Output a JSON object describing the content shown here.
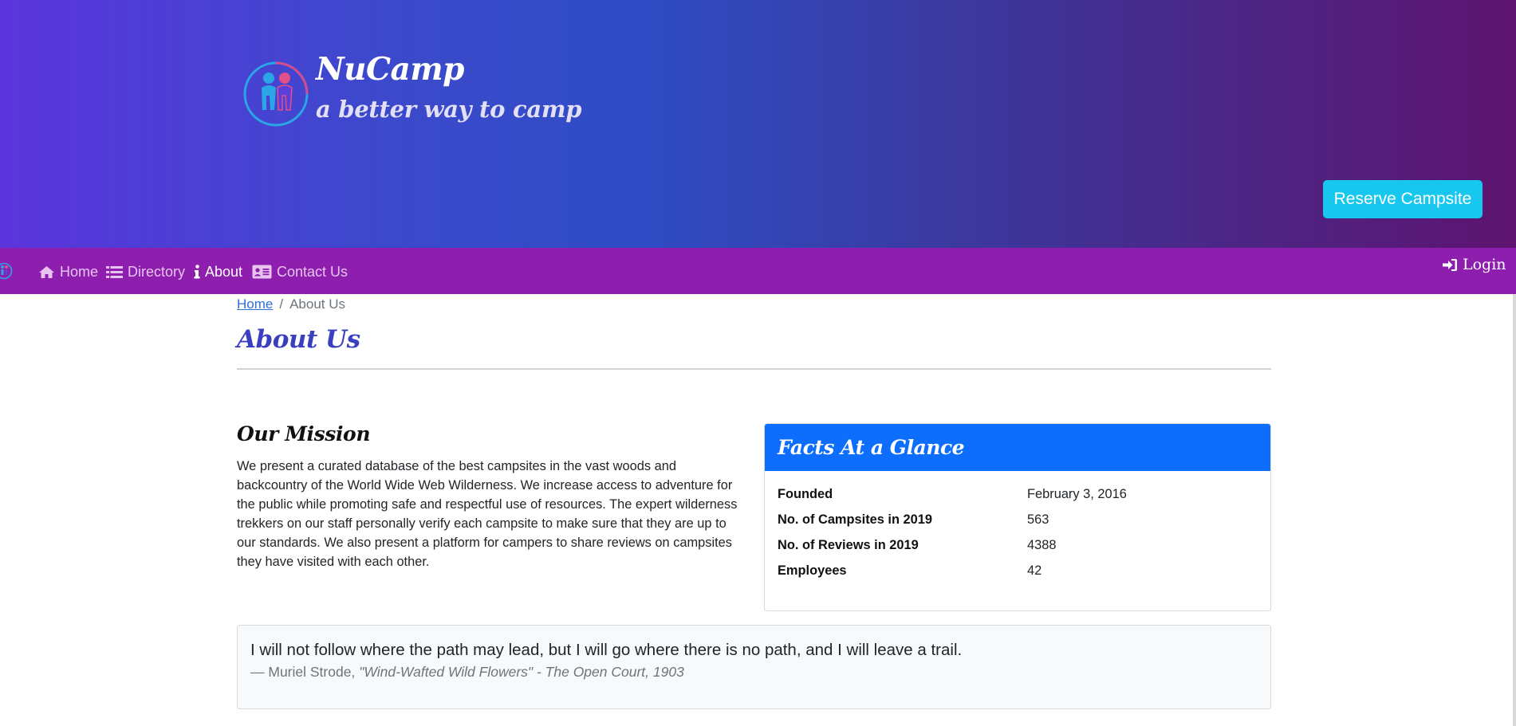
{
  "header": {
    "brand_title": "NuCamp",
    "brand_tagline": "a better way to camp",
    "logo_icon": "nucamp-logo-icon",
    "reserve_label": "Reserve Campsite",
    "colors": {
      "gradient_start": "#5b35dc",
      "gradient_end": "#5e1470",
      "reserve_button": "#17c7ee"
    }
  },
  "navbar": {
    "background": "#8e1fae",
    "items": [
      {
        "label": "Home",
        "icon": "home-icon",
        "active": false
      },
      {
        "label": "Directory",
        "icon": "list-icon",
        "active": false
      },
      {
        "label": "About",
        "icon": "info-icon",
        "active": true
      },
      {
        "label": "Contact Us",
        "icon": "address-card-icon",
        "active": false
      }
    ],
    "login_label": "Login",
    "login_icon": "sign-in-icon"
  },
  "breadcrumb": {
    "home": "Home",
    "separator": "/",
    "current": "About Us"
  },
  "page": {
    "title": "About Us"
  },
  "mission": {
    "heading": "Our Mission",
    "text": "We present a curated database of the best campsites in the vast woods and backcountry of the World Wide Web Wilderness. We increase access to adventure for the public while promoting safe and respectful use of resources. The expert wilderness trekkers on our staff personally verify each campsite to make sure that they are up to our standards. We also present a platform for campers to share reviews on campsites they have visited with each other."
  },
  "facts": {
    "heading": "Facts At a Glance",
    "header_color": "#0d6efd",
    "rows": [
      {
        "label": "Founded",
        "value": "February 3, 2016"
      },
      {
        "label": "No. of Campsites in 2019",
        "value": "563"
      },
      {
        "label": "No. of Reviews in 2019",
        "value": "4388"
      },
      {
        "label": "Employees",
        "value": "42"
      }
    ]
  },
  "quote": {
    "text": "I will not follow where the path may lead, but I will go where there is no path, and I will leave a trail.",
    "author": "— Muriel Strode,",
    "source": "\"Wind-Wafted Wild Flowers\" - The Open Court, 1903"
  }
}
